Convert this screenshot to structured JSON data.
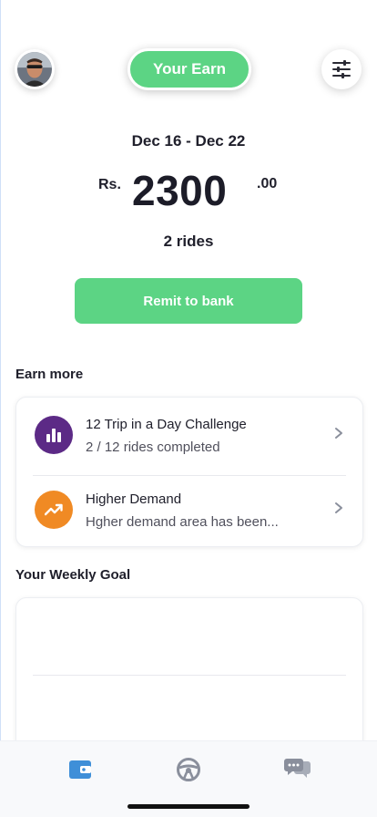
{
  "header": {
    "title": "Your Earn",
    "avatar_icon": "driver-avatar",
    "filter_icon": "sliders-icon"
  },
  "summary": {
    "date_range": "Dec 16 - Dec 22",
    "currency": "Rs.",
    "amount": "2300",
    "decimals": ".00",
    "rides": "2 rides"
  },
  "actions": {
    "remit_label": "Remit to bank"
  },
  "earn_more": {
    "title": "Earn more",
    "items": [
      {
        "title": "12 Trip in a Day Challenge",
        "subtitle": "2 / 12 rides completed",
        "icon": "bar-chart-icon",
        "color": "#5c2a86"
      },
      {
        "title": "Higher Demand",
        "subtitle": "Hgher demand area has been...",
        "icon": "trending-up-icon",
        "color": "#f08a24"
      }
    ]
  },
  "weekly_goal": {
    "title": "Your Weekly Goal"
  },
  "nav": {
    "items": [
      {
        "icon": "wallet-icon",
        "active": true
      },
      {
        "icon": "steering-wheel-icon",
        "active": false
      },
      {
        "icon": "chat-icon",
        "active": false
      }
    ]
  },
  "colors": {
    "accent": "#5cd484",
    "nav_active": "#3f8fd8",
    "nav_inactive": "#8a8f9c"
  }
}
